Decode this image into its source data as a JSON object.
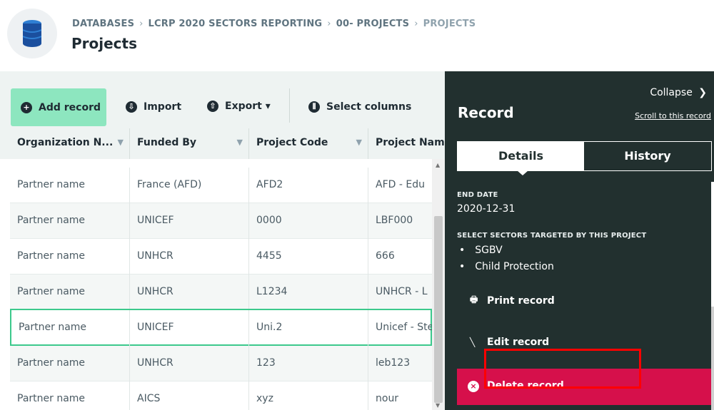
{
  "header": {
    "breadcrumb": [
      "DATABASES",
      "LCRP 2020 SECTORS REPORTING",
      "00- PROJECTS",
      "PROJECTS"
    ],
    "breadcrumb_sep": "›",
    "title": "Projects"
  },
  "toolbar": {
    "add_label": "Add record",
    "import_label": "Import",
    "export_label": "Export ▾",
    "select_label": "Select columns"
  },
  "table": {
    "columns": [
      "Organization N...",
      "Funded By",
      "Project Code",
      "Project Name"
    ],
    "rows": [
      [
        "Partner name",
        "France (AFD)",
        "AFD2",
        "AFD - Edu"
      ],
      [
        "Partner name",
        "UNICEF",
        "0000",
        "LBF000"
      ],
      [
        "Partner name",
        "UNHCR",
        "4455",
        "666"
      ],
      [
        "Partner name",
        "UNHCR",
        "L1234",
        "UNHCR - L"
      ],
      [
        "Partner name",
        "UNICEF",
        "Uni.2",
        "Unicef - Ste"
      ],
      [
        "Partner name",
        "UNHCR",
        "123",
        "leb123"
      ],
      [
        "Partner name",
        "AICS",
        "xyz",
        "nour"
      ]
    ],
    "selected_row": 4
  },
  "panel": {
    "collapse_label": "Collapse",
    "title": "Record",
    "scroll_link": "Scroll to this record",
    "tabs": [
      "Details",
      "History"
    ],
    "end_date_label": "END DATE",
    "end_date_value": "2020-12-31",
    "sectors_label": "SELECT SECTORS TARGETED BY THIS PROJECT",
    "sectors": [
      "SGBV",
      "Child Protection"
    ],
    "print_label": "Print record",
    "edit_label": "Edit record",
    "delete_label": "Delete record"
  },
  "colors": {
    "accent_green": "#8de6bf",
    "panel_bg": "#22302f",
    "delete_red": "#d6104b",
    "selection_green": "#3cc98c",
    "annotation_red": "#ff0000"
  }
}
